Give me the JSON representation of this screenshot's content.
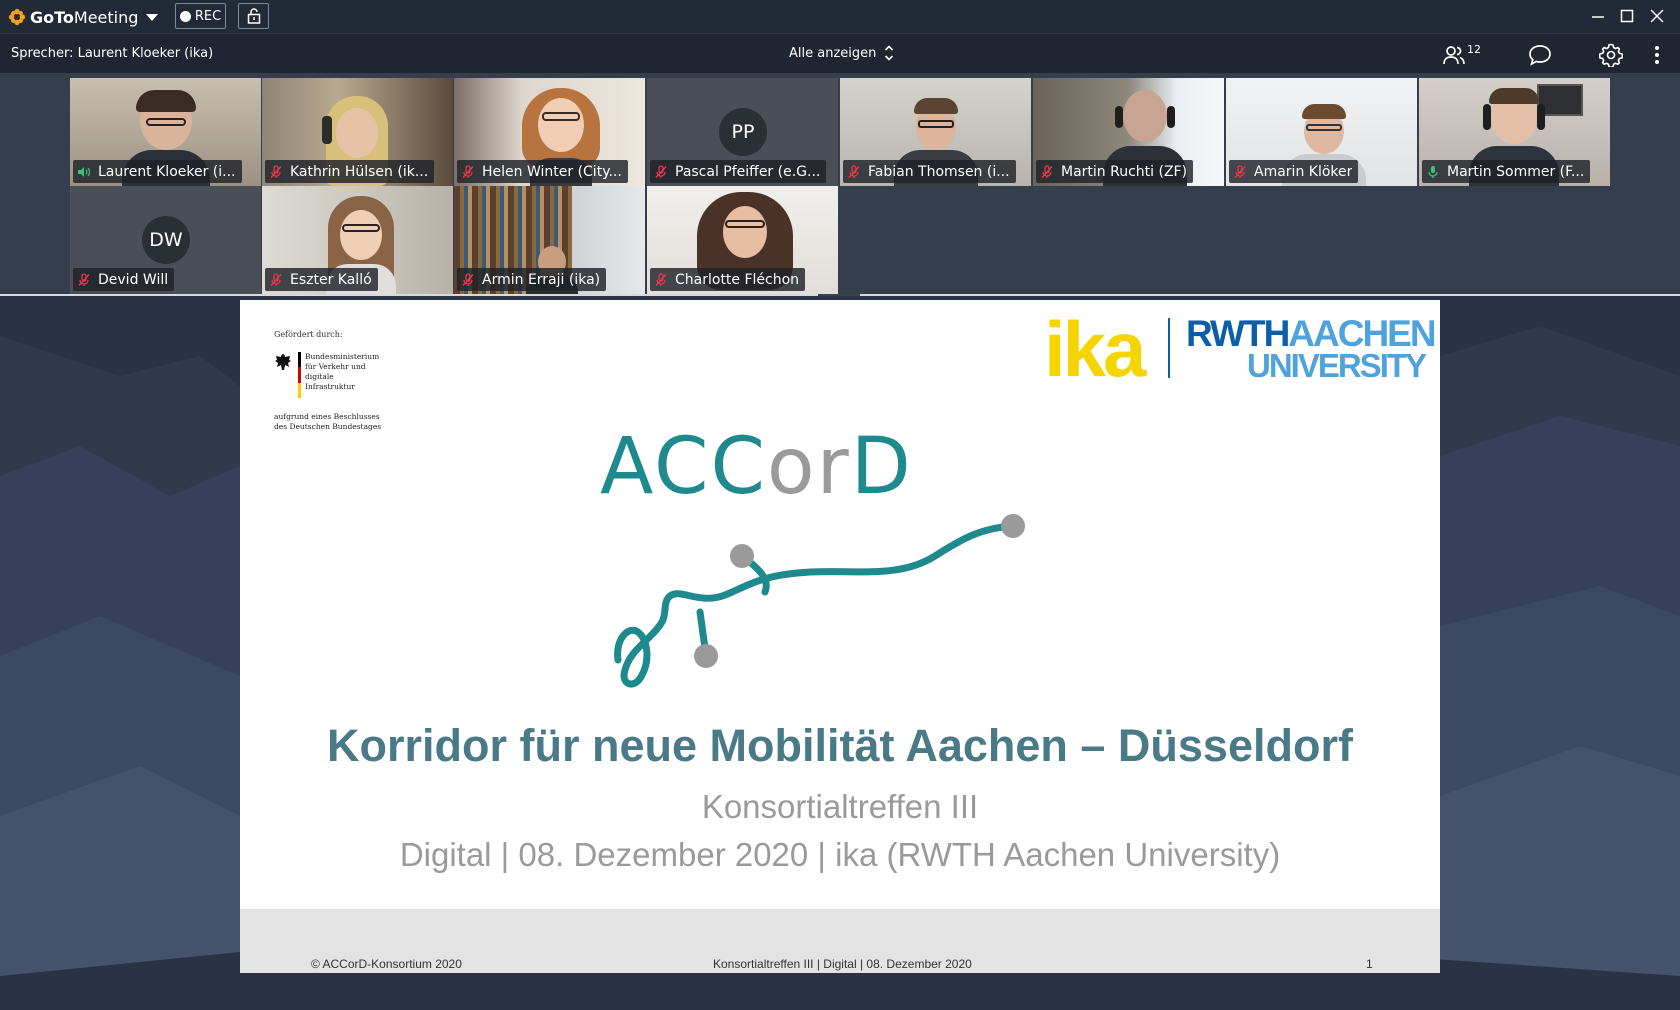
{
  "app": {
    "name_bold": "GoTo",
    "name_rest": "Meeting",
    "rec_label": "REC"
  },
  "infobar": {
    "speaker": "Sprecher: Laurent Kloeker (ika)",
    "view_mode": "Alle anzeigen",
    "participant_count": "12"
  },
  "participants": [
    {
      "name": "Laurent Kloeker (i...",
      "mic": "speaking",
      "avatar": "video"
    },
    {
      "name": "Kathrin Hülsen (ik...",
      "mic": "muted",
      "avatar": "video"
    },
    {
      "name": "Helen Winter (City...",
      "mic": "muted",
      "avatar": "video"
    },
    {
      "name": "Pascal Pfeiffer (e.G...",
      "mic": "muted",
      "avatar": "PP"
    },
    {
      "name": "Fabian Thomsen (i...",
      "mic": "muted",
      "avatar": "video"
    },
    {
      "name": "Martin Ruchti (ZF)",
      "mic": "muted",
      "avatar": "video"
    },
    {
      "name": "Amarin Klöker",
      "mic": "muted",
      "avatar": "video"
    },
    {
      "name": "Martin Sommer (F...",
      "mic": "on",
      "avatar": "video"
    },
    {
      "name": "Devid Will",
      "mic": "muted",
      "avatar": "DW"
    },
    {
      "name": "Eszter Kalló",
      "mic": "muted",
      "avatar": "video"
    },
    {
      "name": "Armin Erraji (ika)",
      "mic": "muted",
      "avatar": "video"
    },
    {
      "name": "Charlotte Fléchon",
      "mic": "muted",
      "avatar": "video"
    }
  ],
  "slide": {
    "funded_by": "Gefördert durch:",
    "ministry": "Bundesministerium für Verkehr und digitale Infrastruktur",
    "ministry_sub": "aufgrund eines Beschlusses des Deutschen Bundestages",
    "logo_ika": "ika",
    "logo_rwth_a": "RWTH",
    "logo_rwth_b": "AACHEN",
    "logo_rwth_c": "UNIVERSITY",
    "brand_a": "ACC",
    "brand_b": "or",
    "brand_c": "D",
    "title": "Korridor für neue Mobilität Aachen – Düsseldorf",
    "subtitle": "Konsortialtreffen III",
    "subline": "Digital | 08. Dezember 2020 | ika (RWTH Aachen University)",
    "footer_left": "© ACCorD-Konsortium 2020",
    "footer_center": "Konsortialtreffen III | Digital | 08. Dezember 2020",
    "footer_right": "1"
  },
  "colors": {
    "accent_teal": "#1f8a8d",
    "title_teal": "#4a7a86",
    "ika_yellow": "#f6d400",
    "rwth_blue": "#0b5ea8",
    "mic_muted": "#e8394d",
    "mic_on": "#3cc37a"
  },
  "icons": [
    "goto-flower-icon",
    "chevron-down-icon",
    "record-dot-icon",
    "lock-icon",
    "minimize-icon",
    "maximize-icon",
    "close-icon",
    "sort-arrows-icon",
    "people-icon",
    "chat-icon",
    "gear-icon",
    "more-vertical-icon",
    "mic-muted-icon",
    "mic-speaking-icon",
    "mic-on-icon"
  ]
}
